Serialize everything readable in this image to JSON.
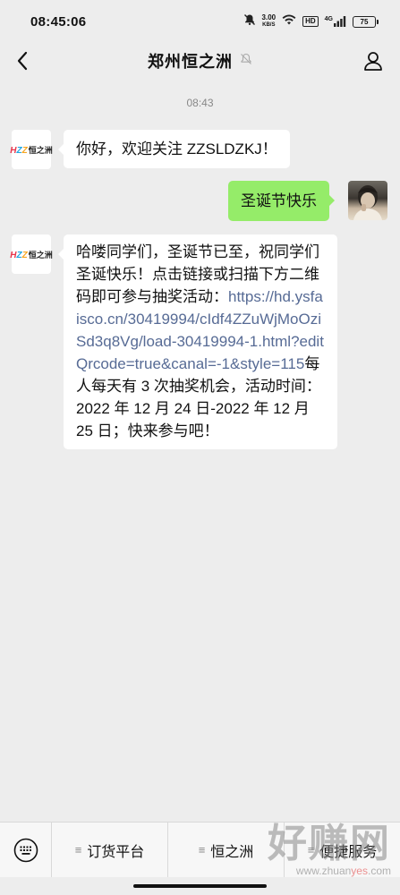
{
  "status_bar": {
    "time": "08:45:06",
    "speed_value": "3.00",
    "speed_unit": "KB/S",
    "hd_label": "HD",
    "network_label": "4G",
    "battery_level": "75"
  },
  "nav": {
    "title": "郑州恒之洲"
  },
  "chat": {
    "timestamp": "08:43",
    "logo_letters": [
      "H",
      "Z",
      "Z"
    ],
    "logo_text": "恒之洲",
    "msg1": "你好，欢迎关注 ZZSLDZKJ！",
    "msg2": "圣诞节快乐",
    "msg3_text_before": "哈喽同学们，圣诞节已至，祝同学们圣诞快乐！点击链接或扫描下方二维码即可参与抽奖活动：",
    "msg3_link": "https://hd.ysfaisco.cn/30419994/cIdf4ZZuWjMoOziSd3q8Vg/load-30419994-1.html?editQrcode=true&canal=-1&style=115",
    "msg3_text_after": "每人每天有 3 次抽奖机会，活动时间：2022 年 12 月 24 日-2022 年 12 月 25 日；快来参与吧！"
  },
  "menu": {
    "items": [
      {
        "label": "订货平台"
      },
      {
        "label": "恒之洲"
      },
      {
        "label": "便捷服务"
      }
    ]
  },
  "watermark": {
    "main": "好赚网",
    "sub_prefix": "www.zhuan",
    "sub_highlight": "yes",
    "sub_suffix": ".com"
  }
}
